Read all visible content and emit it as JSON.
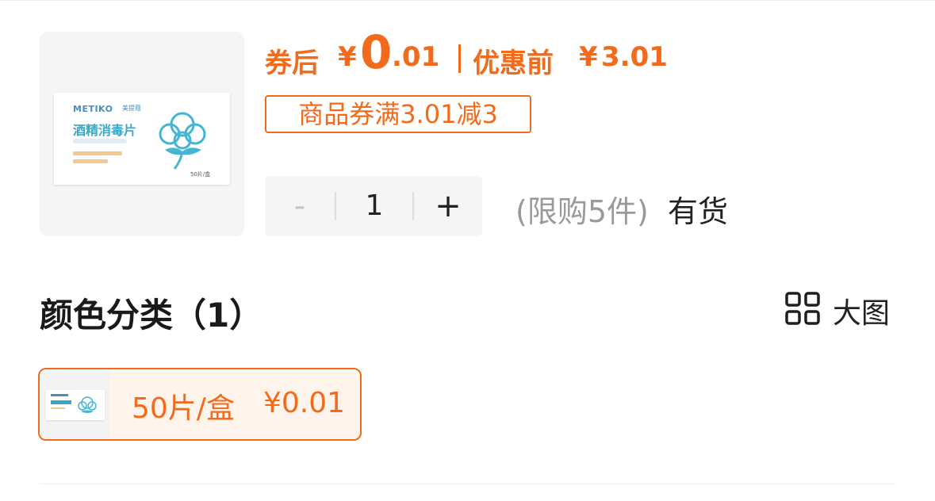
{
  "product": {
    "image_name": "alcohol-wipes-product",
    "box_brand": "METIKO",
    "box_brand_cn": "美提蔻",
    "box_title": "酒精消毒片",
    "box_count": "50片/盒"
  },
  "price": {
    "after_coupon_label": "券后",
    "after_coupon_currency": "¥",
    "after_coupon_int": "0",
    "after_coupon_dec": ".01",
    "before_label": "优惠前",
    "before_currency": "¥",
    "before_value": "3.01"
  },
  "coupon": {
    "text": "商品券满3.01减3"
  },
  "quantity": {
    "minus": "-",
    "value": "1",
    "plus": "+",
    "limit_text": "(限购5件)",
    "stock_text": "有货"
  },
  "variants": {
    "title": "颜色分类（1）",
    "view_toggle_label": "大图",
    "options": [
      {
        "name": "50片/盒",
        "price": "¥0.01"
      }
    ]
  },
  "colors": {
    "accent": "#f26a1b",
    "option_bg": "#fff4ec"
  }
}
